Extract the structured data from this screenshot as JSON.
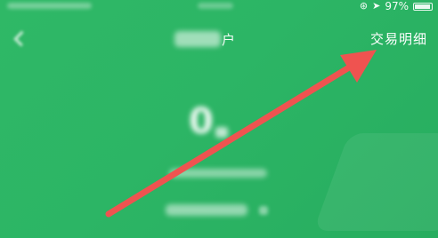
{
  "status_bar": {
    "battery": "97%",
    "icons": [
      "orientation-lock-icon",
      "location-arrow-icon",
      "battery-icon"
    ],
    "battery_level": 0.97
  },
  "nav": {
    "title_visible": "户",
    "action": "交易明细",
    "back_icon": "chevron-left-icon"
  },
  "balance": {
    "amount": "0"
  },
  "annotation": {
    "arrow_color": "#ef5350"
  },
  "colors": {
    "background": "#2cb565",
    "text": "#ffffff"
  }
}
